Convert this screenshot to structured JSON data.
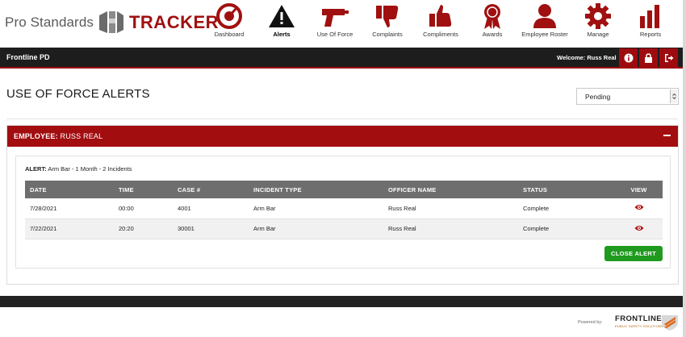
{
  "brand": {
    "prefix": "Pro Standards",
    "name": "TRACKER"
  },
  "nav": [
    {
      "label": "Dashboard",
      "icon": "gauge-icon"
    },
    {
      "label": "Alerts",
      "icon": "warning-icon"
    },
    {
      "label": "Use Of Force",
      "icon": "taser-icon"
    },
    {
      "label": "Complaints",
      "icon": "thumbs-down-icon"
    },
    {
      "label": "Compliments",
      "icon": "thumbs-up-icon"
    },
    {
      "label": "Awards",
      "icon": "award-ribbon-icon"
    },
    {
      "label": "Employee Roster",
      "icon": "person-icon"
    },
    {
      "label": "Manage",
      "icon": "gear-icon"
    },
    {
      "label": "Reports",
      "icon": "bar-chart-icon"
    }
  ],
  "header": {
    "org": "Frontline PD",
    "welcome": "Welcome: Russ Real",
    "buttons": [
      "info-icon",
      "lock-icon",
      "logout-icon"
    ]
  },
  "page": {
    "title": "USE OF FORCE ALERTS",
    "status_filter": "Pending"
  },
  "panel": {
    "label": "EMPLOYEE:",
    "employee": "RUSS REAL",
    "alert_label": "ALERT:",
    "alert_text": "Arm Bar - 1 Month - 2 Incidents",
    "columns": [
      "DATE",
      "TIME",
      "CASE #",
      "INCIDENT TYPE",
      "OFFICER NAME",
      "STATUS",
      "VIEW"
    ],
    "rows": [
      {
        "date": "7/28/2021",
        "time": "00:00",
        "case": "4001",
        "type": "Arm Bar",
        "officer": "Russ Real",
        "status": "Complete"
      },
      {
        "date": "7/22/2021",
        "time": "20:20",
        "case": "30001",
        "type": "Arm Bar",
        "officer": "Russ Real",
        "status": "Complete"
      }
    ],
    "close_label": "CLOSE ALERT"
  },
  "footer": {
    "powered": "Powered by:",
    "company": "FRONTLINE",
    "company_sub": "PUBLIC SAFETY SOLUTIONS"
  },
  "colors": {
    "brand_red": "#a01010",
    "header_black": "#1d1d1d",
    "table_header": "#6e6e6e",
    "close_green": "#1f9a1f"
  }
}
